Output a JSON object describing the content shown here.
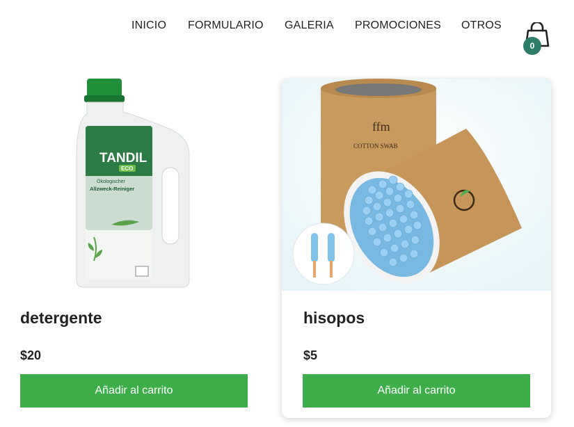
{
  "nav": {
    "items": [
      "INICIO",
      "FORMULARIO",
      "GALERIA",
      "PROMOCIONES",
      "OTROS"
    ]
  },
  "cart": {
    "count": "0",
    "icon": "shopping-bag-icon"
  },
  "products": [
    {
      "name": "detergente",
      "price": "$20",
      "button": "Añadir al carrito",
      "image_brand": "TANDIL",
      "image_sub": "ECO",
      "image_line1": "Ökologischer",
      "image_line2": "Allzweck-Reiniger"
    },
    {
      "name": "hisopos",
      "price": "$5",
      "button": "Añadir al carrito",
      "image_label": "COTTON SWAB"
    }
  ],
  "colors": {
    "accent": "#3dae4a",
    "badge": "#2e7d6a"
  }
}
